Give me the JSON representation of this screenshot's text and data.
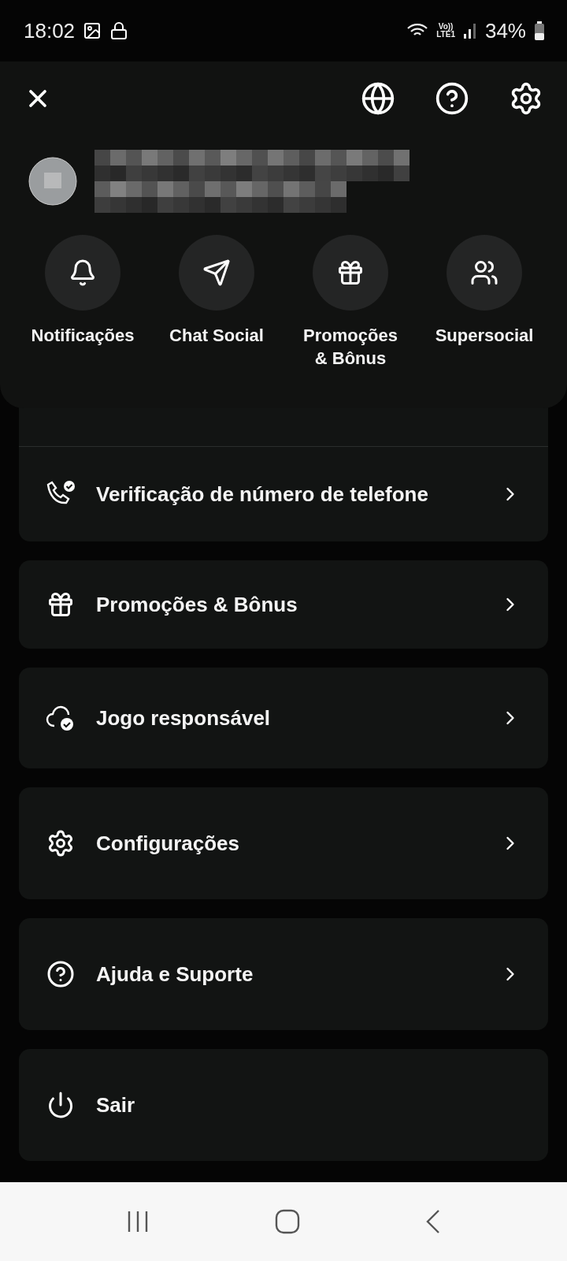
{
  "status_bar": {
    "time": "18:02",
    "network": "Vo))\nLTE1",
    "battery": "34%"
  },
  "shortcuts": [
    {
      "label": "Notificações"
    },
    {
      "label": "Chat Social"
    },
    {
      "label": "Promoções & Bônus"
    },
    {
      "label": "Supersocial"
    }
  ],
  "menu": [
    {
      "rows": [
        {
          "label": "Verificação de número de telefone",
          "chevron": true
        }
      ]
    },
    {
      "rows": [
        {
          "label": "Promoções & Bônus",
          "chevron": true
        }
      ]
    },
    {
      "rows": [
        {
          "label": "Jogo responsável",
          "chevron": true
        }
      ]
    },
    {
      "rows": [
        {
          "label": "Configurações",
          "chevron": true
        }
      ]
    },
    {
      "rows": [
        {
          "label": "Ajuda e Suporte",
          "chevron": true
        }
      ]
    },
    {
      "rows": [
        {
          "label": "Sair",
          "chevron": false
        }
      ]
    }
  ]
}
